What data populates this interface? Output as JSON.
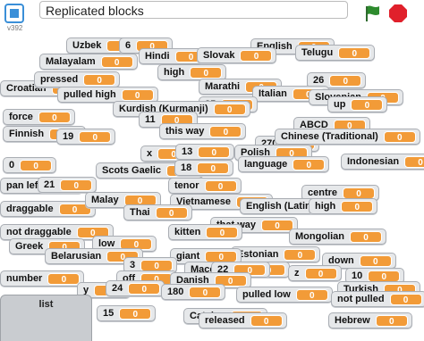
{
  "app": {
    "version": "v392",
    "title": "Replicated blocks"
  },
  "icons": {
    "logo": "fullscreen-icon",
    "flag": "green-flag-icon",
    "stop": "stop-icon"
  },
  "colors": {
    "value_bg": "#f29b38",
    "monitor_bg": "#e6e8ea",
    "flag": "#2e8b2e",
    "stop": "#e0202b"
  },
  "monitors": [
    {
      "label": "Uzbek",
      "value": "0"
    },
    {
      "label": "6",
      "value": "0"
    },
    {
      "label": "English",
      "value": "0"
    },
    {
      "label": "Telugu",
      "value": "0"
    },
    {
      "label": "Malayalam",
      "value": "0"
    },
    {
      "label": "Hindi",
      "value": "0"
    },
    {
      "label": "Slovak",
      "value": "0"
    },
    {
      "label": "high",
      "value": "0"
    },
    {
      "label": "Croatian",
      "value": "0"
    },
    {
      "label": "pressed",
      "value": "0"
    },
    {
      "label": "Marathi",
      "value": "0"
    },
    {
      "label": "26",
      "value": "0"
    },
    {
      "label": "pulled high",
      "value": "0"
    },
    {
      "label": "Italian",
      "value": "0"
    },
    {
      "label": "Slovenian",
      "value": "0"
    },
    {
      "label": "25",
      "value": "0"
    },
    {
      "label": "up",
      "value": "0"
    },
    {
      "label": "force",
      "value": "0"
    },
    {
      "label": "Kurdish (Kurmanji)",
      "value": "0"
    },
    {
      "label": "11",
      "value": "0"
    },
    {
      "label": "ABCD",
      "value": "0"
    },
    {
      "label": "Finnish",
      "value": "0"
    },
    {
      "label": "19",
      "value": "0"
    },
    {
      "label": "this way",
      "value": "0"
    },
    {
      "label": "270",
      "value": "0"
    },
    {
      "label": "Chinese (Traditional)",
      "value": "0"
    },
    {
      "label": "x",
      "value": "0"
    },
    {
      "label": "13",
      "value": "0"
    },
    {
      "label": "Polish",
      "value": "0"
    },
    {
      "label": "0",
      "value": "0"
    },
    {
      "label": "Scots Gaelic",
      "value": "0"
    },
    {
      "label": "18",
      "value": "0"
    },
    {
      "label": "language",
      "value": "0"
    },
    {
      "label": "Indonesian",
      "value": "0"
    },
    {
      "label": "pan left",
      "value": "0"
    },
    {
      "label": "21",
      "value": "0"
    },
    {
      "label": "tenor",
      "value": "0"
    },
    {
      "label": "centre",
      "value": "0"
    },
    {
      "label": "draggable",
      "value": "0"
    },
    {
      "label": "Malay",
      "value": "0"
    },
    {
      "label": "Vietnamese",
      "value": "0"
    },
    {
      "label": "English (Latin)",
      "value": "0"
    },
    {
      "label": "Thai",
      "value": "0"
    },
    {
      "label": "high",
      "value": "0"
    },
    {
      "label": "not draggable",
      "value": "0"
    },
    {
      "label": "that way",
      "value": "0"
    },
    {
      "label": "kitten",
      "value": "0"
    },
    {
      "label": "Mongolian",
      "value": "0"
    },
    {
      "label": "Greek",
      "value": "0"
    },
    {
      "label": "low",
      "value": "0"
    },
    {
      "label": "Belarusian",
      "value": "0"
    },
    {
      "label": "Estonian",
      "value": "0"
    },
    {
      "label": "giant",
      "value": "0"
    },
    {
      "label": "down",
      "value": "0"
    },
    {
      "label": "3",
      "value": "0"
    },
    {
      "label": "Macedonian",
      "value": "0"
    },
    {
      "label": "22",
      "value": "0"
    },
    {
      "label": "z",
      "value": "0"
    },
    {
      "label": "number",
      "value": "0"
    },
    {
      "label": "off",
      "value": "0"
    },
    {
      "label": "Danish",
      "value": "0"
    },
    {
      "label": "10",
      "value": "0"
    },
    {
      "label": "y",
      "value": "0"
    },
    {
      "label": "24",
      "value": "0"
    },
    {
      "label": "180",
      "value": "0"
    },
    {
      "label": "pulled low",
      "value": "0"
    },
    {
      "label": "Turkish",
      "value": "0"
    },
    {
      "label": "not pulled",
      "value": "0"
    },
    {
      "label": "15",
      "value": "0"
    },
    {
      "label": "Catalan",
      "value": "0"
    },
    {
      "label": "released",
      "value": "0"
    },
    {
      "label": "Hebrew",
      "value": "0"
    }
  ],
  "list_monitor": {
    "label": "list"
  }
}
